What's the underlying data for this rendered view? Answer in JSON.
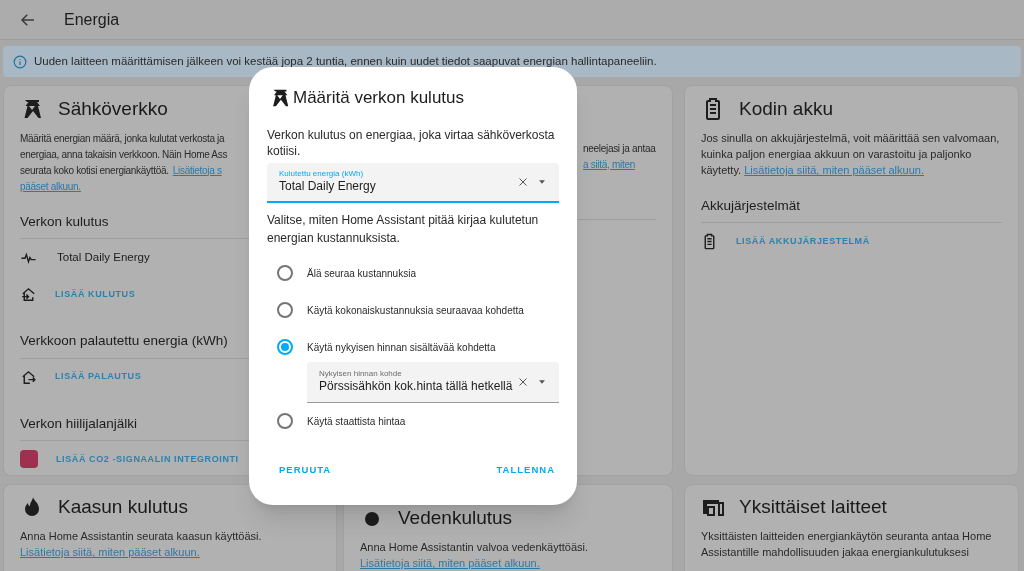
{
  "header": {
    "title": "Energia"
  },
  "info_banner": {
    "text": "Uuden laitteen määrittämisen jälkeen voi kestää jopa 2 tuntia, ennen kuin uudet tiedot saapuvat energian hallintapaneeliin."
  },
  "cards": [
    {
      "kind": "grid",
      "title": "Sähköverkko",
      "description_lines": [
        {
          "text": "Määritä energian määrä, jonka kulutat verkosta ja"
        },
        {
          "text": "energiaa, anna takaisin verkkoon. Näin Home Ass"
        },
        {
          "text": "seurata koko kotisi energiankäyttöä.",
          "link": "Lisätietoja s"
        },
        {
          "link": "pääset alkuun."
        }
      ],
      "sections": [
        {
          "heading": "Verkon kulutus",
          "rows": [
            {
              "kind": "entity",
              "label": "Total Daily Energy"
            },
            {
              "kind": "add_consumption",
              "label": "LISÄÄ KULUTUS"
            }
          ]
        },
        {
          "heading": "Verkkoon palautettu energia (kWh)",
          "rows": [
            {
              "kind": "add_return",
              "label": "LISÄÄ PALAUTUS"
            }
          ]
        },
        {
          "heading": "Verkon hiilijalanjälki",
          "rows": [
            {
              "kind": "co2",
              "label": "LISÄÄ CO2 -SIGNAALIN INTEGROINTI"
            }
          ]
        }
      ]
    },
    {
      "kind": "hidden",
      "description_lines": [
        {
          "text": "neelejasi ja antaa"
        },
        {
          "link": "a siitä, miten"
        }
      ]
    },
    {
      "kind": "battery",
      "title": "Kodin akku",
      "description": "Jos sinulla on akkujärjestelmä, voit määrittää sen valvomaan, kuinka paljon energiaa akkuun on varastoitu ja paljonko käytetty.",
      "link": "Lisätietoja siitä, miten pääset alkuun.",
      "sections": [
        {
          "heading": "Akkujärjestelmät",
          "rows": [
            {
              "kind": "add_battery",
              "label": "LISÄÄ AKKUJÄRJESTELMÄ"
            }
          ]
        }
      ]
    },
    {
      "kind": "gas",
      "title": "Kaasun kulutus",
      "description": "Anna Home Assistantin seurata kaasun käyttöäsi.",
      "link": "Lisätietoja siitä, miten pääset alkuun."
    },
    {
      "kind": "water",
      "title": "Vedenkulutus",
      "description": "Anna Home Assistantin valvoa vedenkäyttöäsi.",
      "link": "Lisätietoja siitä, miten pääset alkuun."
    },
    {
      "kind": "devices",
      "title": "Yksittäiset laitteet",
      "description": "Yksittäisten laitteiden energiankäytön seuranta antaa Home Assistantille mahdollisuuden jakaa energiankulutuksesi"
    }
  ],
  "dialog": {
    "title": "Määritä verkon kulutus",
    "intro": "Verkon kulutus on energiaa, joka virtaa sähköverkosta kotiisi.",
    "energy_field": {
      "label": "Kulutettu energia (kWh)",
      "value": "Total Daily Energy"
    },
    "cost_prompt": "Valitse, miten Home Assistant pitää kirjaa kulutetun energian kustannuksista.",
    "options": [
      {
        "label": "Älä seuraa kustannuksia",
        "selected": false
      },
      {
        "label": "Käytä kokonaiskustannuksia seuraavaa kohdetta",
        "selected": false
      },
      {
        "label": "Käytä nykyisen hinnan sisältävää kohdetta",
        "selected": true,
        "field": {
          "label": "Nykyisen hinnan kohde",
          "value": "Pörssisähkön kok.hinta tällä hetkellä"
        }
      },
      {
        "label": "Käytä staattista hintaa",
        "selected": false
      }
    ],
    "buttons": [
      "PERUUTA",
      "TALLENNA"
    ]
  }
}
